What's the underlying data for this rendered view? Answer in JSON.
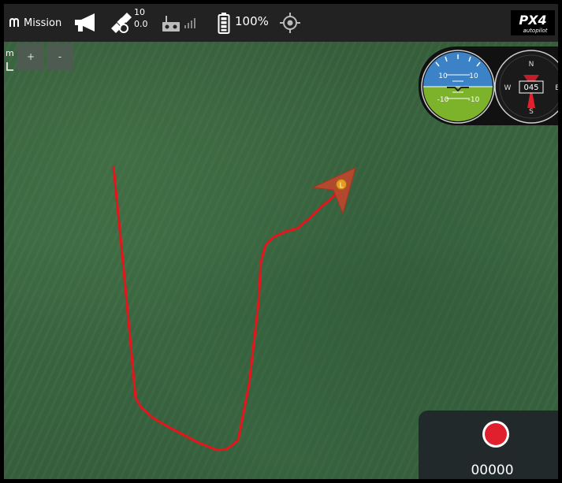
{
  "toolbar": {
    "mission_label": "Mission",
    "gps_satellite_count": "10",
    "gps_hdop": "0.0",
    "battery_percent": "100%",
    "brand_logo_text": "PX4",
    "brand_logo_subtext": "autopilot"
  },
  "map": {
    "scale_unit": "m",
    "zoom_in_label": "+",
    "zoom_out_label": "-",
    "vehicle_marker_label": "L",
    "track_color": "#e8141c",
    "vehicle_color": "#c8442a"
  },
  "instruments": {
    "attitude_pitch_labels": [
      "10",
      "10",
      "-10",
      "-10"
    ],
    "compass_heading": "045",
    "compass_labels": {
      "north": "N",
      "east": "E",
      "south": "S",
      "west": "W"
    }
  },
  "record": {
    "counter": "00000"
  },
  "icons": [
    "mission-icon",
    "megaphone-icon",
    "satellite-icon",
    "remote-controller-icon",
    "signal-strength-icon",
    "battery-icon",
    "gps-lock-icon",
    "record-icon"
  ]
}
